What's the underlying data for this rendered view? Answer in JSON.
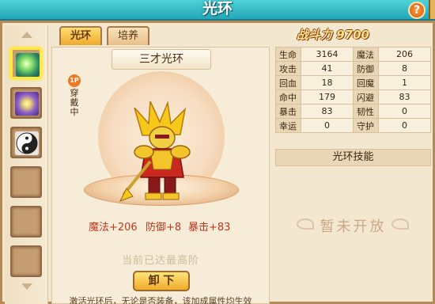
{
  "window": {
    "title": "光环"
  },
  "help_label": "?",
  "tabs": [
    {
      "label": "光环"
    },
    {
      "label": "培养"
    }
  ],
  "aura": {
    "name": "三才光环",
    "equip_badge": "1P",
    "equip_status": "穿戴中",
    "bonuses": [
      {
        "label": "魔法+206"
      },
      {
        "label": "防御+8"
      },
      {
        "label": "暴击+83"
      }
    ],
    "maxed_text": "当前已达最高阶",
    "unequip_label": "卸 下",
    "footnote": "激活光环后，无论是否装备，该加成属性均生效"
  },
  "slots": [
    {
      "icon": "green-sparkle-aura-icon",
      "selected": true
    },
    {
      "icon": "purple-sparkle-aura-icon",
      "selected": false
    },
    {
      "icon": "yin-yang-aura-icon",
      "selected": false
    },
    {
      "icon": "empty",
      "selected": false
    },
    {
      "icon": "empty",
      "selected": false
    },
    {
      "icon": "empty",
      "selected": false
    }
  ],
  "power": {
    "label": "战斗力",
    "value": "9700"
  },
  "stats": [
    {
      "k1": "生命",
      "v1": "3164",
      "k2": "魔法",
      "v2": "206"
    },
    {
      "k1": "攻击",
      "v1": "41",
      "k2": "防御",
      "v2": "8"
    },
    {
      "k1": "回血",
      "v1": "18",
      "k2": "回魔",
      "v2": "1"
    },
    {
      "k1": "命中",
      "v1": "179",
      "k2": "闪避",
      "v2": "83"
    },
    {
      "k1": "暴击",
      "v1": "83",
      "k2": "韧性",
      "v2": "0"
    },
    {
      "k1": "幸运",
      "v1": "0",
      "k2": "守护",
      "v2": "0"
    }
  ],
  "skill": {
    "header": "光环技能",
    "status": "暂未开放"
  },
  "colors": {
    "accent": "#24a6b7",
    "highlight": "#ffea3a",
    "bonus_text": "#c2361a"
  }
}
